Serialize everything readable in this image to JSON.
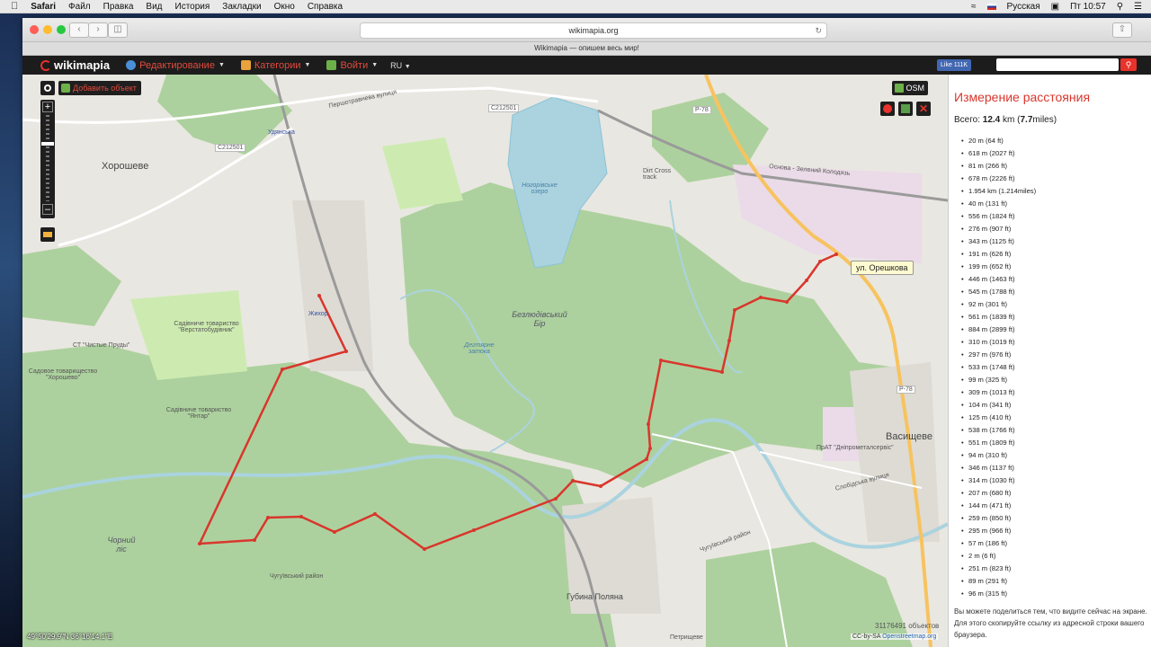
{
  "menubar": {
    "app": "Safari",
    "items": [
      "Файл",
      "Правка",
      "Вид",
      "История",
      "Закладки",
      "Окно",
      "Справка"
    ],
    "input_source": "Русская",
    "clock": "Пт 10:57"
  },
  "browser": {
    "url": "wikimapia.org",
    "tab_title": "Wikimapia — опишем весь мир!"
  },
  "header": {
    "logo": "wikimapia",
    "menu_edit": "Редактирование",
    "menu_categories": "Категории",
    "menu_login": "Войти",
    "lang": "RU",
    "fb_like": "Like 111K"
  },
  "map": {
    "add_object": "Добавить объект",
    "layer": "OSM",
    "tooltip": "ул. Орешкова",
    "coords": "49°50'29.9\"N 36°16'14.1\"E",
    "objects_count": "31176491 объектов",
    "attribution_license": "CC-by-SA",
    "attribution_link": "Openstreetmap.org",
    "labels": {
      "khoroshevo": "Хорошеве",
      "vasishchevo": "Васищеве",
      "bezlyudivsky_bir": "Безлюдівський Бір",
      "chorny_lis": "Чорний ліс",
      "gubina_polyana": "Губина Поляна",
      "nogorivske_ozero": "Ногорівське озеро",
      "zhikhor": "Жихор",
      "udyanska": "Удянська",
      "road_c212501_a": "C212501",
      "road_c212501_b": "C212501",
      "road_r78_a": "Р-78",
      "road_r78_b": "Р-78",
      "pervomaiskaya": "Першотравнева вулиця",
      "gardens_chisti": "СТ \"Чистые Пруды\"",
      "gardens_verkhnyi": "Садовое товарищество \"Хорошево\"",
      "gardens_verstat": "Садівниче товариство \"Верстатобудівник\"",
      "gardens_yantar": "Садівниче товариство \"Янтар\"",
      "dirt_cross": "Dirt Cross track",
      "prat": "ПрАТ \"Дніпрометалсервіс\"",
      "chuguivsky_1": "Чугуївський район",
      "chuguivsky_2": "Чугуївський район",
      "petrishcheve": "Петрищеве",
      "osnova": "Основа - Зелений Колодязь",
      "slobidska": "Слобідська вулиця",
      "desyatyna": "Дегтярне затока"
    }
  },
  "panel": {
    "title": "Измерение расстояния",
    "total_label": "Всего:",
    "total_km": "12.4",
    "total_km_unit": "km",
    "total_miles": "7.7",
    "total_miles_unit": "miles",
    "segments": [
      "20 m (64 ft)",
      "618 m (2027 ft)",
      "81 m (266 ft)",
      "678 m (2226 ft)",
      "1.954 km (1.214miles)",
      "40 m (131 ft)",
      "556 m (1824 ft)",
      "276 m (907 ft)",
      "343 m (1125 ft)",
      "191 m (626 ft)",
      "199 m (652 ft)",
      "446 m (1463 ft)",
      "545 m (1788 ft)",
      "92 m (301 ft)",
      "561 m (1839 ft)",
      "884 m (2899 ft)",
      "310 m (1019 ft)",
      "297 m (976 ft)",
      "533 m (1748 ft)",
      "99 m (325 ft)",
      "309 m (1013 ft)",
      "104 m (341 ft)",
      "125 m (410 ft)",
      "538 m (1766 ft)",
      "551 m (1809 ft)",
      "94 m (310 ft)",
      "346 m (1137 ft)",
      "314 m (1030 ft)",
      "207 m (680 ft)",
      "144 m (471 ft)",
      "259 m (850 ft)",
      "295 m (966 ft)",
      "57 m (186 ft)",
      "2 m (6 ft)",
      "251 m (823 ft)",
      "89 m (291 ft)",
      "96 m (315 ft)"
    ],
    "note": "Вы можете поделиться тем, что видите сейчас на экране. Для этого скопируйте ссылку из адресной строки вашего браузера."
  },
  "colors": {
    "route": "#d9362c",
    "forest": "#add19e",
    "water": "#aad3df",
    "accent": "#e8322b"
  }
}
